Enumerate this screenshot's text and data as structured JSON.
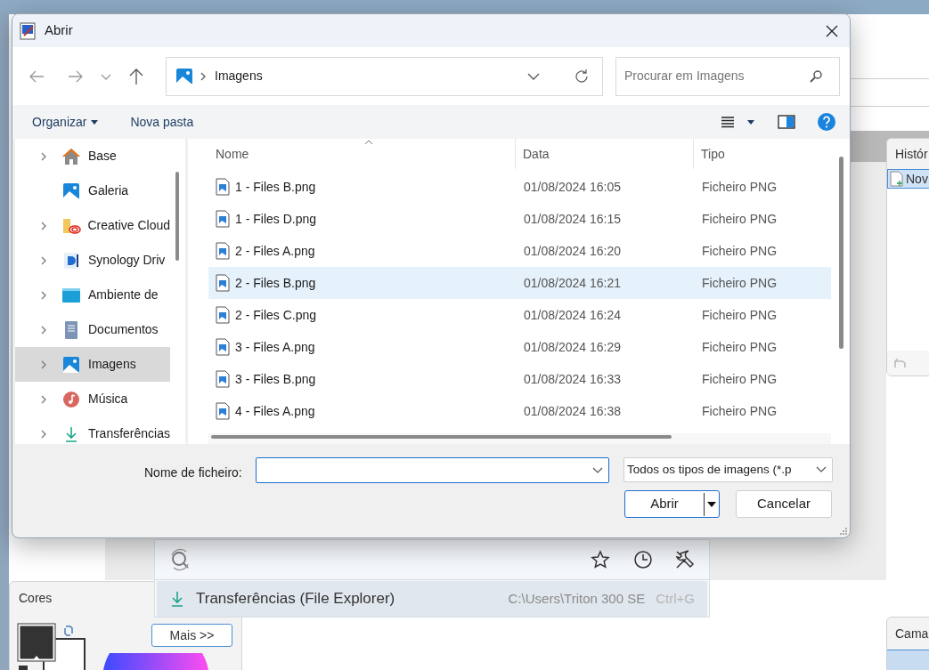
{
  "dialog": {
    "title": "Abrir",
    "location": "Imagens",
    "search": {
      "placeholder": "Procurar em Imagens"
    },
    "commands": [
      "Organizar",
      "Nova pasta"
    ],
    "nav": [
      {
        "label": "Base",
        "kind": "home",
        "expandable": true,
        "selected": false
      },
      {
        "label": "Galeria",
        "kind": "gallery",
        "expandable": false,
        "selected": false
      },
      {
        "label": "Creative Cloud",
        "kind": "cloud",
        "expandable": true,
        "selected": false
      },
      {
        "label": "Synology Driv",
        "kind": "drive",
        "expandable": true,
        "selected": false
      },
      {
        "label": "Ambiente de",
        "kind": "desktop",
        "expandable": true,
        "selected": false
      },
      {
        "label": "Documentos",
        "kind": "documents",
        "expandable": true,
        "selected": false
      },
      {
        "label": "Imagens",
        "kind": "pictures",
        "expandable": true,
        "selected": true
      },
      {
        "label": "Música",
        "kind": "music",
        "expandable": true,
        "selected": false
      },
      {
        "label": "Transferências",
        "kind": "downloads",
        "expandable": true,
        "selected": false
      }
    ],
    "columns": [
      "Nome",
      "Data",
      "Tipo"
    ],
    "files": [
      {
        "name": "1 - Files B.png",
        "date": "01/08/2024 16:05",
        "type": "Ficheiro PNG",
        "selected": false
      },
      {
        "name": "1 - Files D.png",
        "date": "01/08/2024 16:15",
        "type": "Ficheiro PNG",
        "selected": false
      },
      {
        "name": "2 - Files A.png",
        "date": "01/08/2024 16:20",
        "type": "Ficheiro PNG",
        "selected": false
      },
      {
        "name": "2 - Files B.png",
        "date": "01/08/2024 16:21",
        "type": "Ficheiro PNG",
        "selected": true
      },
      {
        "name": "2 - Files C.png",
        "date": "01/08/2024 16:24",
        "type": "Ficheiro PNG",
        "selected": false
      },
      {
        "name": "3 - Files A.png",
        "date": "01/08/2024 16:29",
        "type": "Ficheiro PNG",
        "selected": false
      },
      {
        "name": "3 - Files B.png",
        "date": "01/08/2024 16:33",
        "type": "Ficheiro PNG",
        "selected": false
      },
      {
        "name": "4 - Files A.png",
        "date": "01/08/2024 16:38",
        "type": "Ficheiro PNG",
        "selected": false
      }
    ],
    "filename_label": "Nome de ficheiro:",
    "filetype": "Todos os tipos de imagens (*.p",
    "buttons": [
      "Abrir",
      "Cancelar"
    ]
  },
  "background": {
    "history": {
      "title": "Histór",
      "items": [
        "Nov"
      ]
    },
    "colors": {
      "title": "Cores",
      "button": "Mais >>"
    },
    "layers": {
      "title": "Cama"
    },
    "quick_search": {
      "result": {
        "label": "Transferências (File Explorer)",
        "path": "C:\\Users\\Triton 300 SE",
        "shortcut": "Ctrl+G"
      }
    }
  }
}
